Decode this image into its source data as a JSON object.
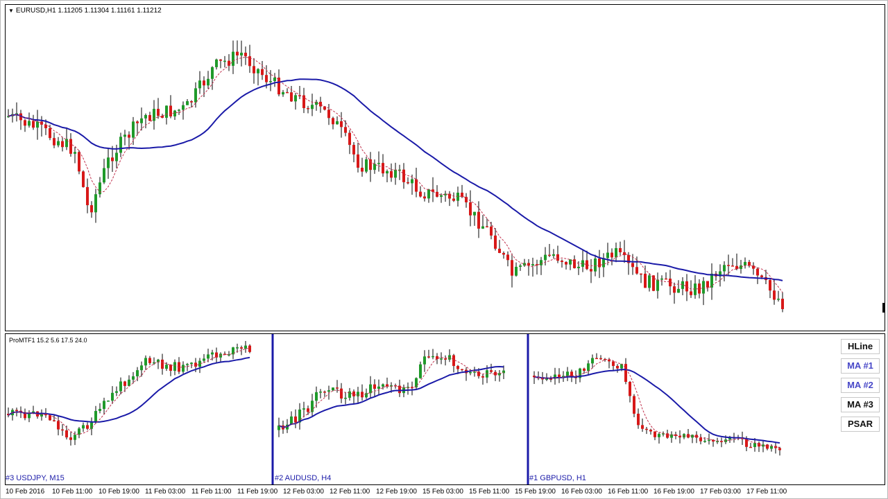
{
  "main_chart": {
    "symbol_line": "EURUSD,H1  1.11205 1.11304 1.11161 1.11212"
  },
  "indicator": {
    "label": "ProMTF1 15.2 5.6 17.5 24.0"
  },
  "subcharts": [
    {
      "label": "#3 USDJPY, M15"
    },
    {
      "label": "#2 AUDUSD, H4"
    },
    {
      "label": "#1 GBPUSD, H1"
    }
  ],
  "buttons": [
    {
      "label": "HLine",
      "style": "dark"
    },
    {
      "label": "MA #1",
      "style": "blue"
    },
    {
      "label": "MA #2",
      "style": "blue"
    },
    {
      "label": "MA #3",
      "style": "dark"
    },
    {
      "label": "PSAR",
      "style": "dark"
    }
  ],
  "time_axis": [
    "10 Feb 2016",
    "10 Feb 11:00",
    "10 Feb 19:00",
    "11 Feb 03:00",
    "11 Feb 11:00",
    "11 Feb 19:00",
    "12 Feb 03:00",
    "12 Feb 11:00",
    "12 Feb 19:00",
    "15 Feb 03:00",
    "15 Feb 11:00",
    "15 Feb 19:00",
    "16 Feb 03:00",
    "16 Feb 11:00",
    "16 Feb 19:00",
    "17 Feb 03:00",
    "17 Feb 11:00"
  ],
  "colors": {
    "bull": "#1f9a2a",
    "bear": "#d81818",
    "ma_slow": "#1a1aa8",
    "ma_fast": "#c0304c",
    "panel_divider": "#1a1aa8"
  }
}
